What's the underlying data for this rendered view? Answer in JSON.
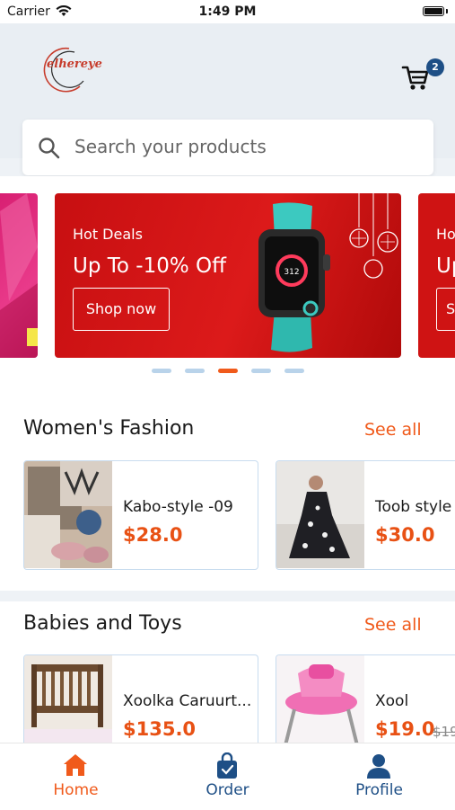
{
  "status_bar": {
    "carrier": "Carrier",
    "time": "1:49 PM"
  },
  "header": {
    "logo_text": "elhereye",
    "cart_count": "2"
  },
  "search": {
    "placeholder": "Search your products"
  },
  "banners": {
    "main": {
      "tag": "Hot Deals",
      "title": "Up To -10% Off",
      "button": "Shop now",
      "watch_display": "312"
    },
    "next": {
      "tag": "Ho",
      "title": "Up",
      "button": "S"
    },
    "pagination": {
      "count": 5,
      "active_index": 2
    }
  },
  "sections": [
    {
      "title": "Women's Fashion",
      "see_all": "See all",
      "products": [
        {
          "name": "Kabo-style -09",
          "price": "$28.0",
          "image": "zara-boxes-shoes"
        },
        {
          "name": "Toob style",
          "price": "$30.0",
          "image": "floral-dress-model"
        }
      ]
    },
    {
      "title": "Babies and Toys",
      "see_all": "See all",
      "products": [
        {
          "name": "Xoolka Caruurt...",
          "price": "$135.0",
          "image": "wooden-crib"
        },
        {
          "name": "Xool",
          "price": "$19.0",
          "old_price": "$19",
          "image": "pink-baby-walker"
        }
      ]
    }
  ],
  "tabbar": {
    "items": [
      {
        "label": "Home",
        "icon": "home-icon",
        "active": true
      },
      {
        "label": "Order",
        "icon": "shopping-bag-icon",
        "active": false
      },
      {
        "label": "Profile",
        "icon": "person-icon",
        "active": false
      }
    ]
  },
  "colors": {
    "accent": "#f05a1b",
    "navy": "#1e4f86",
    "banner_red": "#d31414",
    "dot_inactive": "#b9d3ea",
    "card_border": "#c8dcef"
  }
}
